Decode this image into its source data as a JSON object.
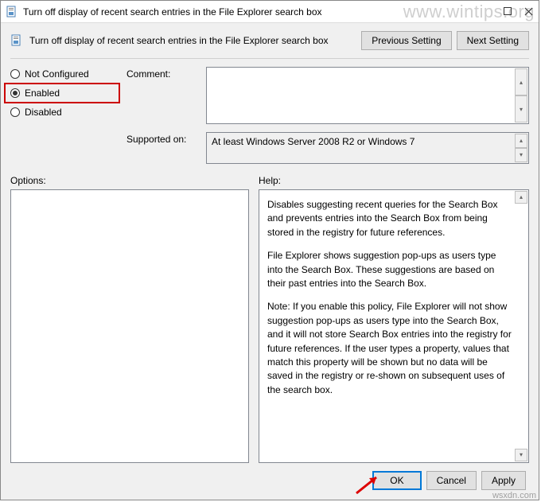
{
  "titlebar": {
    "title": "Turn off display of recent search entries in the File Explorer search box"
  },
  "header": {
    "title": "Turn off display of recent search entries in the File Explorer search box",
    "prev_btn": "Previous Setting",
    "next_btn": "Next Setting"
  },
  "radios": {
    "not_configured": "Not Configured",
    "enabled": "Enabled",
    "disabled": "Disabled",
    "selected": "enabled"
  },
  "comment": {
    "label": "Comment:",
    "value": ""
  },
  "supported": {
    "label": "Supported on:",
    "value": "At least Windows Server 2008 R2 or Windows 7"
  },
  "options": {
    "label": "Options:"
  },
  "help": {
    "label": "Help:",
    "p1": "Disables suggesting recent queries for the Search Box and prevents entries into the Search Box from being stored in the registry for future references.",
    "p2": "File Explorer shows suggestion pop-ups as users type into the Search Box.  These suggestions are based on their past entries into the Search Box.",
    "p3": "Note: If you enable this policy, File Explorer will not show suggestion pop-ups as users type into the Search Box, and it will not store Search Box entries into the registry for future references.  If the user types a property, values that match this property will be shown but no data will be saved in the registry or re-shown on subsequent uses of the search box."
  },
  "footer": {
    "ok": "OK",
    "cancel": "Cancel",
    "apply": "Apply"
  },
  "watermark": "www.wintips.org",
  "watermark2": "wsxdn.com"
}
